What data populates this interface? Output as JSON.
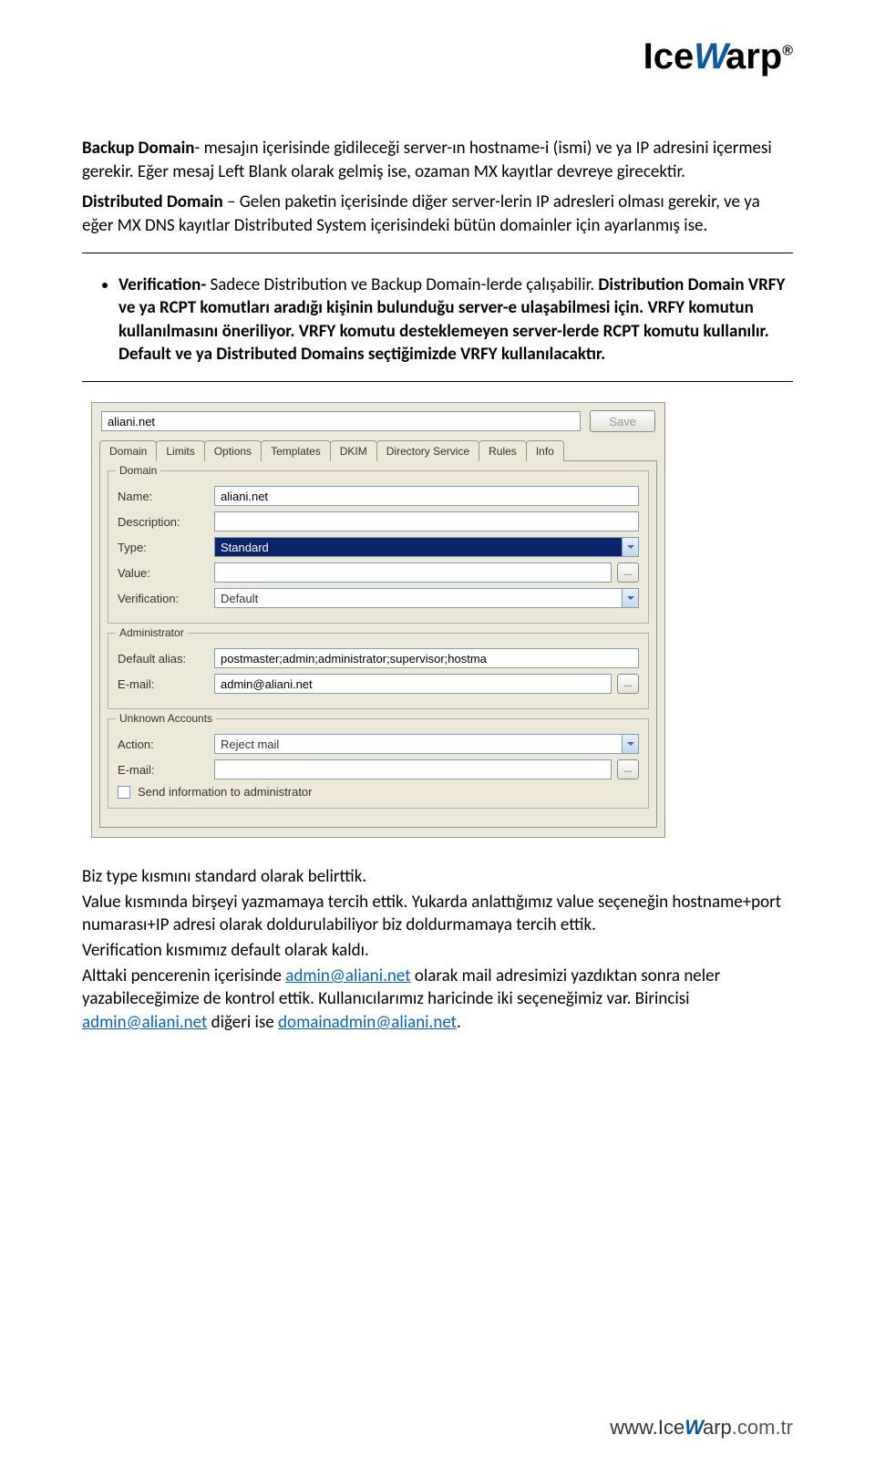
{
  "logo": {
    "prefix": "Ice",
    "w": "W",
    "suffix": "arp",
    "reg": "®"
  },
  "para1_prefix": "Backup Domain",
  "para1_rest": "- mesajın içerisinde gidileceği server-ın hostname-i (ismi) ve ya IP adresini içermesi gerekir. Eğer mesaj Left Blank olarak gelmiş ise, ozaman MX kayıtlar devreye girecektir.",
  "para2_prefix": "Distributed Domain",
  "para2_rest": " – Gelen paketin içerisinde diğer server-lerin IP adresleri olması gerekir, ve ya eğer MX DNS kayıtlar Distributed System içerisindeki bütün domainler için ayarlanmış ise.",
  "bullet_prefix": "Verification-",
  "bullet_sentence1": " Sadece Distribution ve Backup Domain-lerde çalışabilir.",
  "bullet_rest": "Distribution Domain VRFY ve ya RCPT komutları aradığı kişinin bulunduğu server-e ulaşabilmesi için. VRFY komutun kullanılmasını öneriliyor. VRFY komutu desteklemeyen server-lerde RCPT komutu kullanılır. Default ve ya Distributed Domains seçtiğimizde VRFY kullanılacaktır.",
  "panel": {
    "top_value": "aliani.net",
    "save_label": "Save",
    "tabs": [
      "Domain",
      "Limits",
      "Options",
      "Templates",
      "DKIM",
      "Directory Service",
      "Rules",
      "Info"
    ],
    "group_domain": {
      "title": "Domain",
      "name_label": "Name:",
      "name_value": "aliani.net",
      "desc_label": "Description:",
      "desc_value": "",
      "type_label": "Type:",
      "type_value": "Standard",
      "value_label": "Value:",
      "value_value": "",
      "verif_label": "Verification:",
      "verif_value": "Default"
    },
    "group_admin": {
      "title": "Administrator",
      "alias_label": "Default alias:",
      "alias_value": "postmaster;admin;administrator;supervisor;hostma",
      "email_label": "E-mail:",
      "email_value": "admin@aliani.net"
    },
    "group_unknown": {
      "title": "Unknown Accounts",
      "action_label": "Action:",
      "action_value": "Reject mail",
      "email_label": "E-mail:",
      "email_value": "",
      "chk_label": "Send information to administrator"
    },
    "dots": "..."
  },
  "bottom": {
    "l1": "Biz type kısmını standard olarak belirttik.",
    "l2": "Value kısmında birşeyi yazmamaya tercih ettik. Yukarda anlattığımız value seçeneğin hostname+port numarası+IP adresi olarak doldurulabiliyor biz doldurmamaya tercih ettik.",
    "l3": "Verification kısmımız default olarak kaldı.",
    "l4a": "Alttaki pencerenin içerisinde ",
    "l4_link1": "admin@aliani.net",
    "l4b": " olarak mail adresimizi yazdıktan sonra neler yazabileceğimize de kontrol ettik. Kullanıcılarımız haricinde iki seçeneğimiz var. Birincisi ",
    "l4_link2": "admin@aliani.net",
    "l4c": " diğeri ise ",
    "l4_link3": "domainadmin@aliani.net",
    "l4d": "."
  },
  "footer": {
    "prefix": "www.",
    "brand1": "Ice",
    "w": "W",
    "brand2": "arp",
    "domain": ".com.tr"
  }
}
